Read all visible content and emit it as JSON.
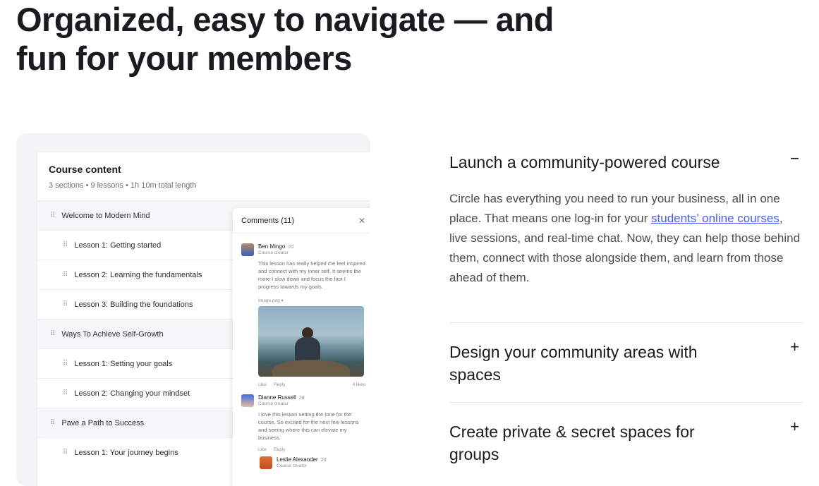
{
  "headline": "Organized, easy to navigate — and fun for your members",
  "course": {
    "title": "Course content",
    "meta": "3 sections • 9 lessons • 1h 10m total length",
    "rows": [
      {
        "type": "section",
        "label": "Welcome to Modern Mind"
      },
      {
        "type": "lesson",
        "label": "Lesson 1: Getting started"
      },
      {
        "type": "lesson",
        "label": "Lesson 2: Learning the fundamentals"
      },
      {
        "type": "lesson",
        "label": "Lesson 3: Building the foundations"
      },
      {
        "type": "section",
        "label": "Ways To Achieve Self-Growth"
      },
      {
        "type": "lesson",
        "label": "Lesson 1: Setting your goals"
      },
      {
        "type": "lesson",
        "label": "Lesson 2: Changing your mindset"
      },
      {
        "type": "section",
        "label": "Pave a Path to Success"
      },
      {
        "type": "lesson",
        "label": "Lesson 1: Your journey begins"
      }
    ]
  },
  "comments": {
    "title": "Comments (11)",
    "close_icon": "close-icon",
    "items": [
      {
        "name": "Ben Mingo",
        "time": "2d",
        "role": "Course creator",
        "text": "This lesson has really helped me feel inspired and connect with my inner self. It seems the more I slow down and focus the fast I progress towards my goals.",
        "attachment": "Image.png ▾",
        "like": "Like",
        "reply": "Reply",
        "likes": "4 likes"
      },
      {
        "name": "Dianne Russell",
        "time": "2d",
        "role": "Course creator",
        "text": "I love this lesson setting the tone for the course. So excited for the next few lessons and seeing where this can elevate my business.",
        "like": "Like",
        "reply": "Reply"
      },
      {
        "name": "Leslie Alexander",
        "time": "2d",
        "role": "Course creator"
      }
    ]
  },
  "accordion": [
    {
      "title": "Launch a community-powered course",
      "toggle": "−",
      "expanded": true,
      "body_before": "Circle has everything you need to run your business, all in one place. That means one log-in for your ",
      "link": "students’ online courses",
      "body_after": ", live sessions, and real-time chat. Now, they can help those behind them, connect with those alongside them, and learn from those ahead of them."
    },
    {
      "title": "Design your community areas with spaces",
      "toggle": "+",
      "expanded": false
    },
    {
      "title": "Create private & secret spaces for groups",
      "toggle": "+",
      "expanded": false
    }
  ],
  "colors": {
    "link": "#4a5df0",
    "card_bg": "#f3f4f6"
  }
}
